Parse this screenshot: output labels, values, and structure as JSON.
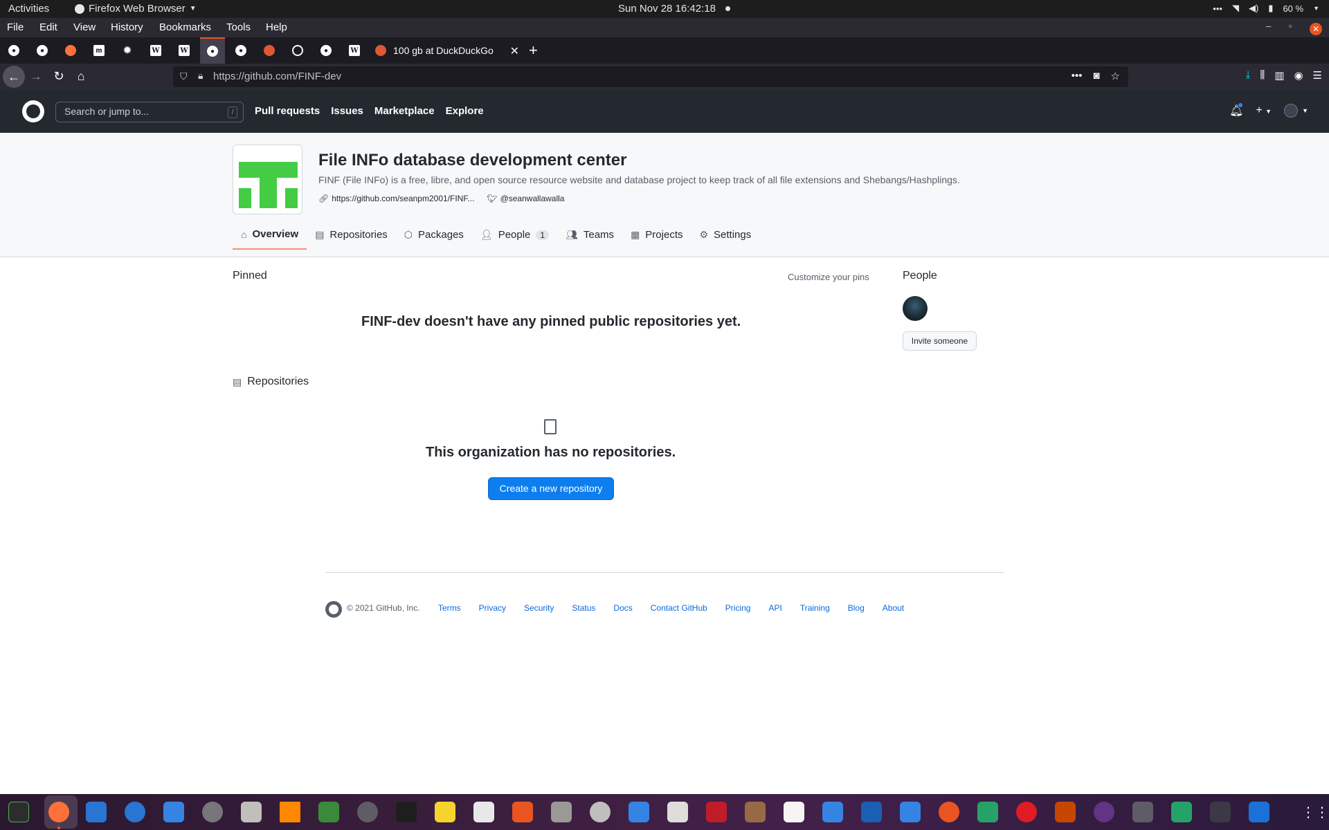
{
  "system": {
    "activities": "Activities",
    "app_name": "Firefox Web Browser",
    "clock": "Sun Nov 28  16:42:18",
    "battery": "60 %"
  },
  "firefox_menu": [
    "File",
    "Edit",
    "View",
    "History",
    "Bookmarks",
    "Tools",
    "Help"
  ],
  "tabs": {
    "active_title": "100 gb at DuckDuckGo",
    "pinned": [
      "github",
      "github",
      "firefox",
      "m",
      "sun",
      "wikipedia",
      "wikipedia",
      "github",
      "github",
      "duckduckgo",
      "globe",
      "github",
      "wikipedia"
    ]
  },
  "urlbar": {
    "url_host": "https://github.com/",
    "url_path": "FINF-dev"
  },
  "github_header": {
    "search_placeholder": "Search or jump to...",
    "search_key": "/",
    "nav": [
      "Pull requests",
      "Issues",
      "Marketplace",
      "Explore"
    ]
  },
  "org": {
    "title": "File INFo database development center",
    "description": "FINF (File INFo) is a free, libre, and open source resource website and database project to keep track of all file extensions and Shebangs/Hashplings.",
    "website": "https://github.com/seanpm2001/FINF...",
    "twitter": "@seanwallawalla",
    "tabs": [
      {
        "label": "Overview",
        "icon": "home-icon",
        "active": true
      },
      {
        "label": "Repositories",
        "icon": "repo-icon"
      },
      {
        "label": "Packages",
        "icon": "package-icon"
      },
      {
        "label": "People",
        "icon": "person-icon",
        "count": "1"
      },
      {
        "label": "Teams",
        "icon": "people-icon"
      },
      {
        "label": "Projects",
        "icon": "project-icon"
      },
      {
        "label": "Settings",
        "icon": "gear-icon"
      }
    ]
  },
  "main": {
    "pinned_title": "Pinned",
    "customize_pins": "Customize your pins",
    "no_pinned": "FINF-dev doesn't have any pinned public repositories yet.",
    "repos_title": "Repositories",
    "no_repos": "This organization has no repositories.",
    "create_repo": "Create a new repository"
  },
  "sidebar": {
    "people_title": "People",
    "invite": "Invite someone"
  },
  "footer": {
    "copyright": "© 2021 GitHub, Inc.",
    "links": [
      "Terms",
      "Privacy",
      "Security",
      "Status",
      "Docs",
      "Contact GitHub",
      "Pricing",
      "API",
      "Training",
      "Blog",
      "About"
    ]
  },
  "colors": {
    "accent": "#0969da",
    "create_button": "#0d7eef",
    "org_logo_green": "#44cc44",
    "tab_underline": "#fd8c73"
  }
}
